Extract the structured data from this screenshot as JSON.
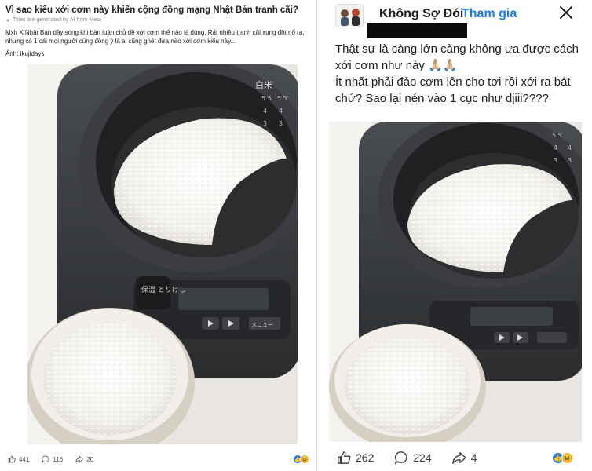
{
  "left_post": {
    "title": "Vì sao kiểu xới cơm này khiến cộng đồng mạng Nhật Bản tranh cãi?",
    "ai_note": "Titles are generated by AI from Meta",
    "description": "Mxh X Nhật Bản dậy sóng khi bàn luận chủ đề xới cơm thế nào là đúng. Rất nhiều tranh cãi xung đột nổ ra, nhưng có 1 cái mọi người cùng đồng ý là ai cũng ghét đứa nào xới cơm kiểu này...",
    "credit": "Ảnh: ikujidays",
    "likes": "441",
    "comments": "116",
    "shares": "20",
    "cooker_label_top": "白米",
    "cooker_panel_text": "保温 とりけし",
    "cooker_button_text": "メニュー"
  },
  "right_post": {
    "page_name": "Không Sợ Đói",
    "separator": "·",
    "join_label": "Tham gia",
    "body_text": "Thật sự là càng lớn càng không ưa được cách xới cơm như này 🙏🏼🙏🏼\nÍt nhất phải đảo cơm lên cho tơi rồi xới ra bát chứ? Sao lại nén vào 1 cục như djiii????",
    "likes": "262",
    "comments": "224",
    "shares": "4"
  },
  "icons": {
    "like": "thumbs-up-icon",
    "comment": "comment-bubble-icon",
    "share": "share-arrow-icon",
    "close": "close-x-icon",
    "reaction_like": "like-reaction-icon",
    "reaction_haha": "haha-reaction-icon"
  },
  "colors": {
    "brand_blue": "#1877f2",
    "haha_yellow": "#f7b125",
    "text_dark": "#1c1e21",
    "text_muted": "#8a8d91"
  }
}
